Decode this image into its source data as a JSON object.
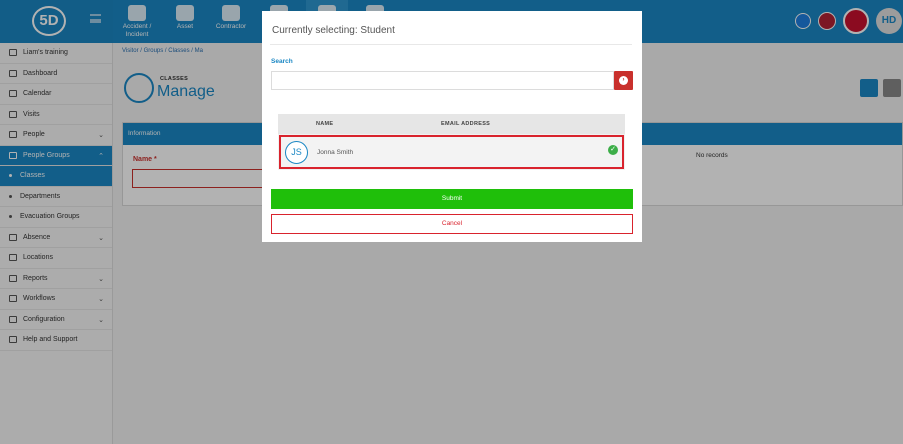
{
  "topbar": {
    "logo": "5D",
    "modules": [
      {
        "label": "Accident / Incident",
        "icon": "warning-icon"
      },
      {
        "label": "Asset",
        "icon": "boxes-icon"
      },
      {
        "label": "Contractor",
        "icon": "hardhat-icon"
      },
      {
        "label": "",
        "icon": "document-icon"
      },
      {
        "label": "",
        "icon": "person-icon"
      },
      {
        "label": "",
        "icon": "hardhat-icon"
      }
    ],
    "user_initials": "HD"
  },
  "sidebar": {
    "items": [
      {
        "label": "Liam's training",
        "icon": "training-icon"
      },
      {
        "label": "Dashboard",
        "icon": "dashboard-icon"
      },
      {
        "label": "Calendar",
        "icon": "calendar-icon"
      },
      {
        "label": "Visits",
        "icon": "visits-icon"
      },
      {
        "label": "People",
        "icon": "people-icon"
      },
      {
        "label": "People Groups",
        "icon": "people-groups-icon"
      },
      {
        "label": "Classes"
      },
      {
        "label": "Departments"
      },
      {
        "label": "Evacuation Groups"
      },
      {
        "label": "Absence",
        "icon": "absence-icon"
      },
      {
        "label": "Locations",
        "icon": "locations-icon"
      },
      {
        "label": "Reports",
        "icon": "reports-icon"
      },
      {
        "label": "Workflows",
        "icon": "workflows-icon"
      },
      {
        "label": "Configuration",
        "icon": "configuration-icon"
      },
      {
        "label": "Help and Support",
        "icon": "help-icon"
      }
    ]
  },
  "main": {
    "breadcrumb": [
      "Visitor",
      "Groups",
      "Classes",
      "Ma"
    ],
    "head_small": "CLASSES",
    "head_big": "Manage",
    "info_title": "Information",
    "name_label": "Name",
    "required_mark": "*",
    "no_records": "No records"
  },
  "modal": {
    "title": "Currently selecting:  Student",
    "search_label": "Search",
    "search_value": "",
    "col_name": "NAME",
    "col_email": "EMAIL ADDRESS",
    "rows": [
      {
        "initials": "JS",
        "name": "Jonna Smith",
        "email": ""
      }
    ],
    "submit": "Submit",
    "cancel": "Cancel"
  },
  "colors": {
    "brand": "#1a87c4",
    "danger": "#d9232d",
    "success": "#1fbf0a"
  }
}
